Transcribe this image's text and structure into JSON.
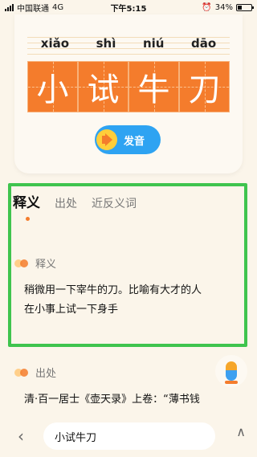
{
  "status_bar": {
    "carrier": "中国联通",
    "network": "4G",
    "time": "下午5:15",
    "battery": "34%",
    "battery_level": 0.34
  },
  "idiom": {
    "pinyin": [
      "xiǎo",
      "shì",
      "niú",
      "dāo"
    ],
    "characters": [
      "小",
      "试",
      "牛",
      "刀"
    ]
  },
  "speak_button": {
    "label": "发音"
  },
  "tabs": [
    {
      "label": "释义"
    },
    {
      "label": "出处"
    },
    {
      "label": "近反义词"
    }
  ],
  "definition_section": {
    "title": "释义",
    "text_line1": "稍微用一下宰牛的刀。比喻有大才的人",
    "text_line2": "在小事上试一下身手"
  },
  "source_section": {
    "title": "出处",
    "text": "清·百一居士《壶天录》上卷：“薄书钱"
  },
  "bottom_bar": {
    "search_value": "小试牛刀",
    "back_icon": "‹",
    "up_icon": "∧"
  },
  "colors": {
    "accent_orange": "#f47c2c",
    "button_blue": "#2ea3f2",
    "highlight_green": "#3fc44e",
    "background": "#fbf5ea"
  }
}
